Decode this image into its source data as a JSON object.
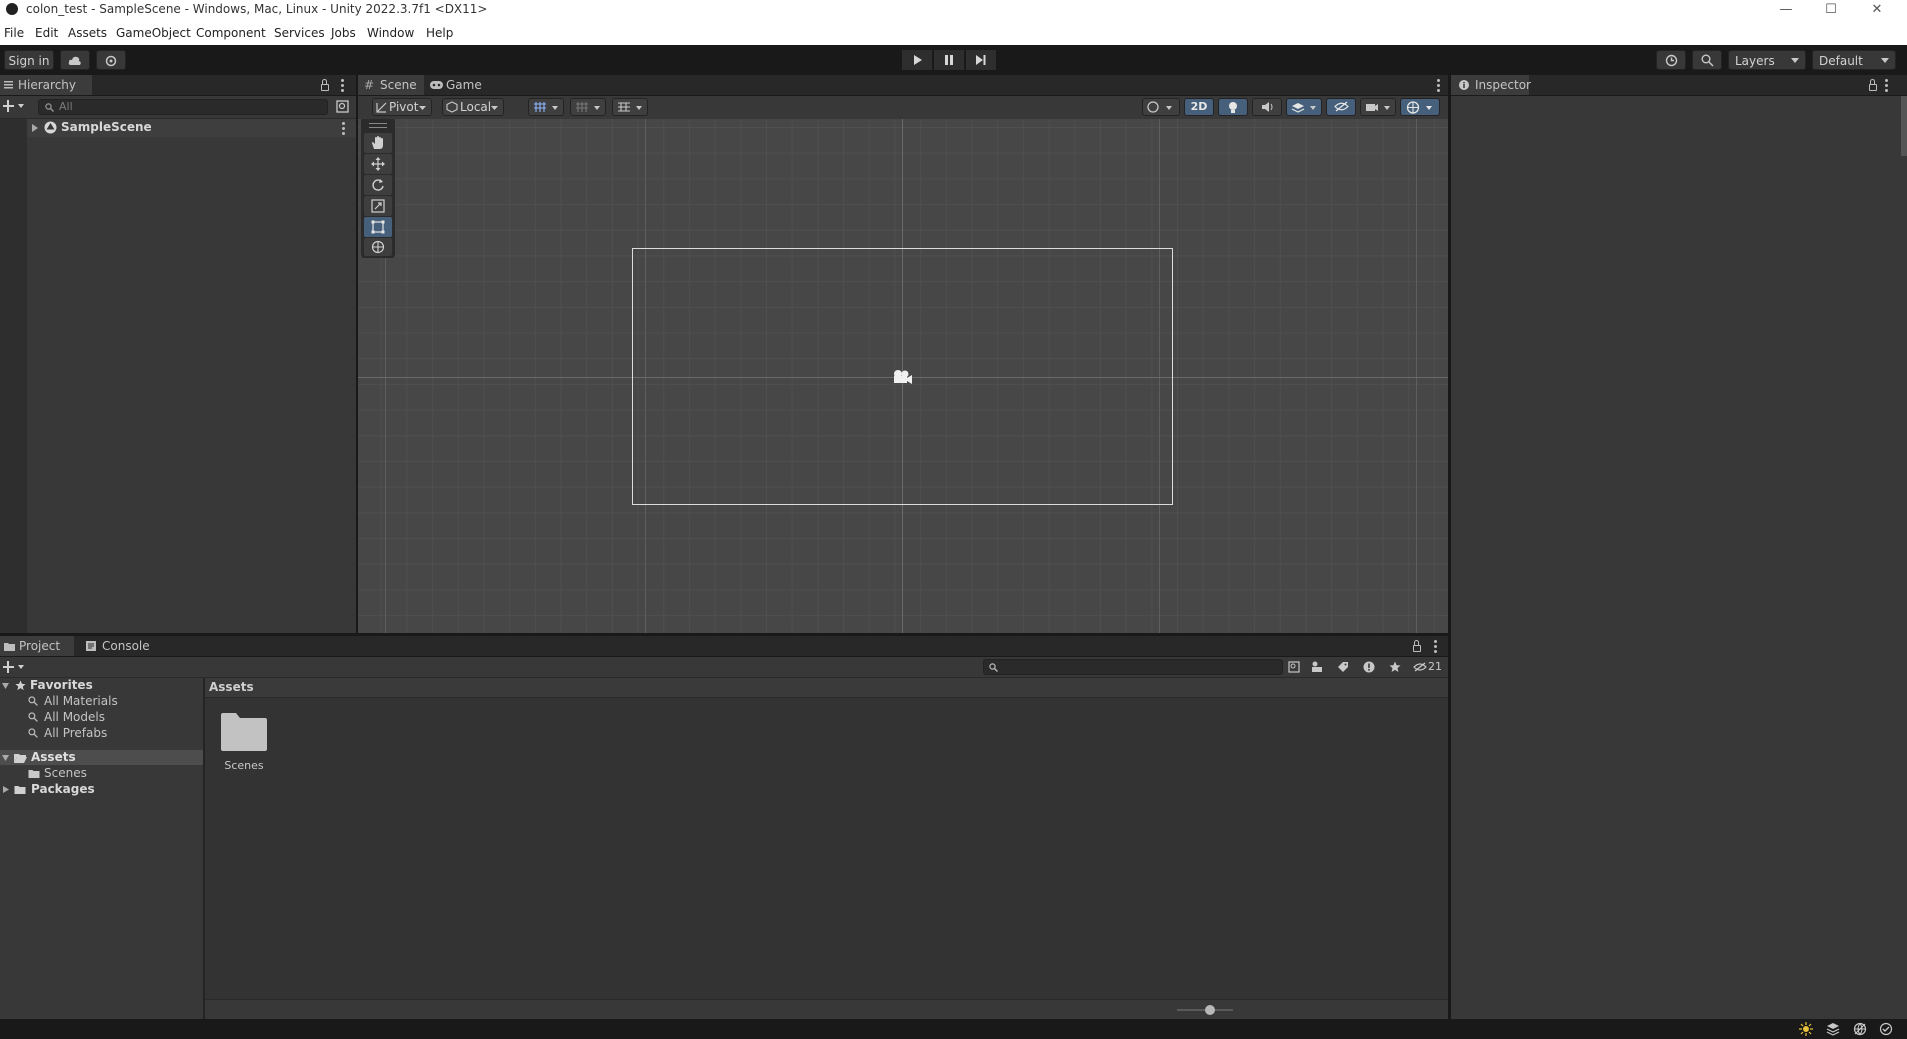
{
  "window": {
    "title": "colon_test - SampleScene - Windows, Mac, Linux - Unity 2022.3.7f1 <DX11>",
    "minimize": "—",
    "maximize": "☐",
    "close": "✕"
  },
  "menubar": [
    "File",
    "Edit",
    "Assets",
    "GameObject",
    "Component",
    "Services",
    "Jobs",
    "Window",
    "Help"
  ],
  "toolbar": {
    "sign_in": "Sign in",
    "layers": "Layers",
    "layout": "Default"
  },
  "hierarchy": {
    "tab": "Hierarchy",
    "search_placeholder": "All",
    "scene_name": "SampleScene"
  },
  "scene": {
    "tabs": [
      "Scene",
      "Game"
    ],
    "pivot": "Pivot",
    "local": "Local",
    "mode_2d": "2D"
  },
  "inspector": {
    "tab": "Inspector"
  },
  "project": {
    "tabs": [
      "Project",
      "Console"
    ],
    "favorites": "Favorites",
    "favorite_items": [
      "All Materials",
      "All Models",
      "All Prefabs"
    ],
    "assets": "Assets",
    "asset_children": [
      "Scenes"
    ],
    "packages": "Packages",
    "breadcrumb": "Assets",
    "hidden_count": "21",
    "grid_items": [
      "Scenes"
    ]
  }
}
